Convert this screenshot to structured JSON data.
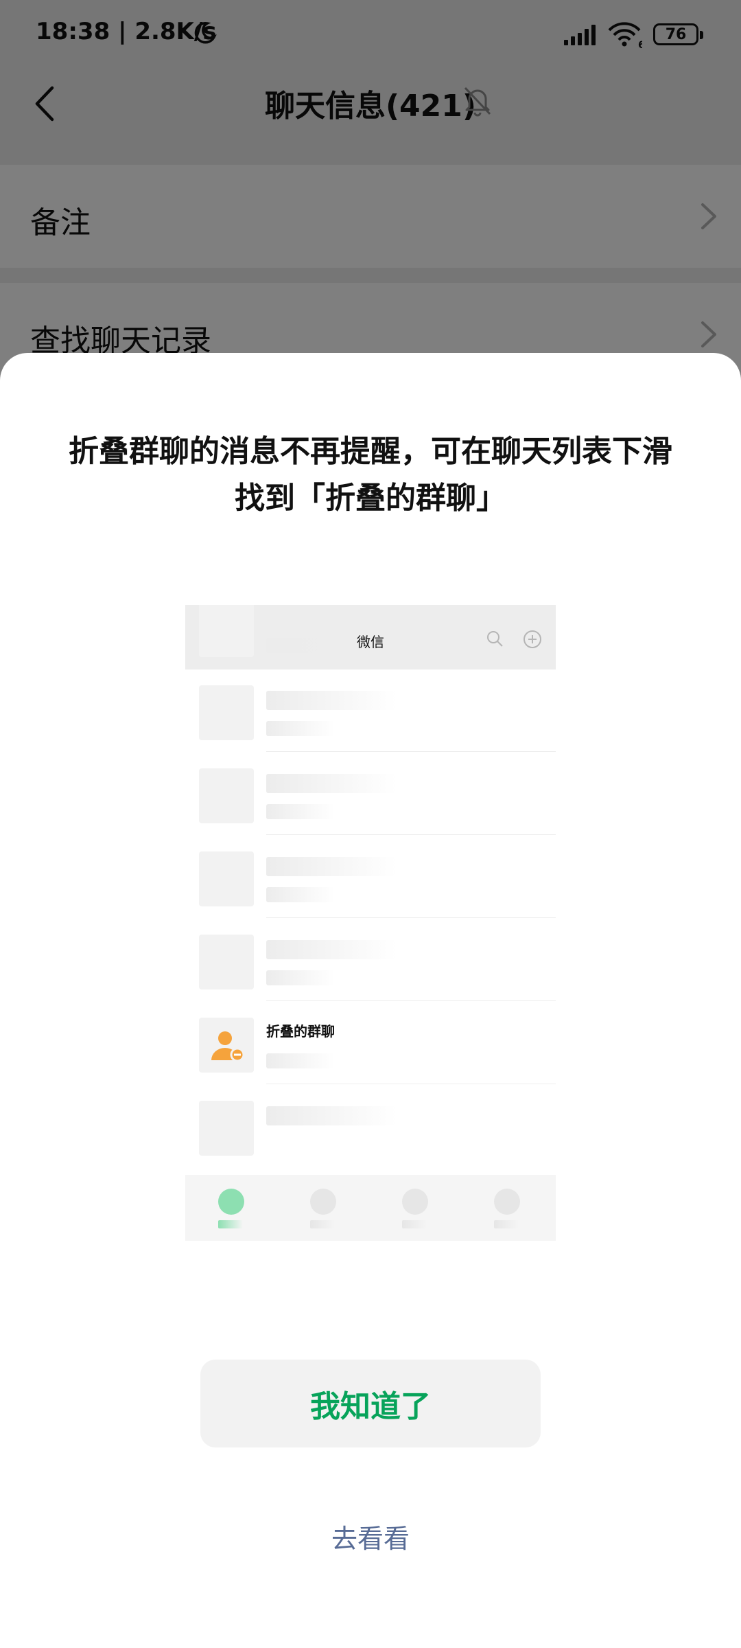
{
  "status_bar": {
    "time": "18:38 | 2.8K/s",
    "battery": "76",
    "wifi_label": "6",
    "icons": [
      "moon-icon",
      "signal-icon",
      "wifi-icon",
      "battery-icon"
    ]
  },
  "navbar": {
    "title": "聊天信息(421)",
    "icons": [
      "back-icon",
      "muted-bell-icon"
    ]
  },
  "settings_rows": [
    {
      "label": "备注"
    },
    {
      "label": "查找聊天记录"
    }
  ],
  "sheet": {
    "title": "折叠群聊的消息不再提醒，可在聊天列表下滑找到「折叠的群聊」",
    "preview": {
      "header_title": "微信",
      "folded_item_name": "折叠的群聊",
      "icons": [
        "search-icon",
        "add-circle-icon",
        "folded-group-icon"
      ],
      "active_tab_color": "#8ddfb1"
    },
    "ok_button": "我知道了",
    "go_link": "去看看"
  },
  "colors": {
    "accent_green": "#07a35a",
    "link_blue": "#576b95",
    "overlay": "rgba(0,0,0,0.5)",
    "group_icon_orange": "#f5a33c"
  }
}
